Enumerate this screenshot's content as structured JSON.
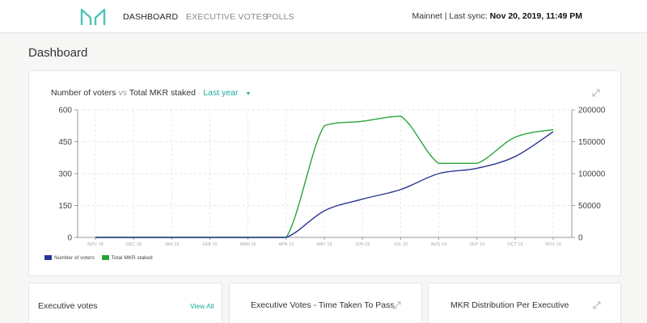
{
  "nav": {
    "dashboard": "DASHBOARD",
    "executive_votes": "EXECUTIVE VOTES",
    "polls": "POLLS"
  },
  "network": {
    "prefix": "Mainnet | Last sync: ",
    "sync_time": "Nov 20, 2019, 11:49 PM"
  },
  "page_title": "Dashboard",
  "main_chart": {
    "title_a": "Number of voters",
    "vs": "vs",
    "title_b": "Total MKR staked",
    "sep": "·",
    "range": "Last year",
    "caret": "▼",
    "expand_icon": "expand-icon"
  },
  "bottom": {
    "executive_votes": "Executive votes",
    "view_all": "View All",
    "time_to_pass": "Executive Votes - Time Taken To Pass",
    "mkr_distribution": "MKR Distribution Per Executive"
  },
  "colors": {
    "voters": "#2b3593",
    "mkr": "#29a437",
    "accent": "#1aab9b"
  },
  "chart_data": {
    "type": "line",
    "title": "Number of voters vs Total MKR staked",
    "categories": [
      "NOV 18",
      "DEC 18",
      "JAN 19",
      "FEB 19",
      "MAR 19",
      "APR 19",
      "MAY 19",
      "JUN 19",
      "JUL 19",
      "AUG 19",
      "SEP 19",
      "OCT 19",
      "NOV 19"
    ],
    "series": [
      {
        "name": "Number of voters",
        "axis": "left",
        "values": [
          0,
          0,
          0,
          0,
          0,
          0,
          125,
          180,
          225,
          300,
          325,
          380,
          497
        ]
      },
      {
        "name": "Total MKR staked",
        "axis": "right",
        "values": [
          0,
          0,
          0,
          0,
          0,
          0,
          175000,
          182000,
          190000,
          116000,
          116000,
          157000,
          169000
        ]
      }
    ],
    "y_left": {
      "ticks": [
        0,
        150,
        300,
        450,
        600
      ],
      "ylim": [
        0,
        600
      ]
    },
    "y_right": {
      "ticks": [
        0,
        50000,
        100000,
        150000,
        200000
      ],
      "ylim": [
        0,
        200000
      ]
    },
    "grid": true,
    "legend": "bottom-left"
  }
}
